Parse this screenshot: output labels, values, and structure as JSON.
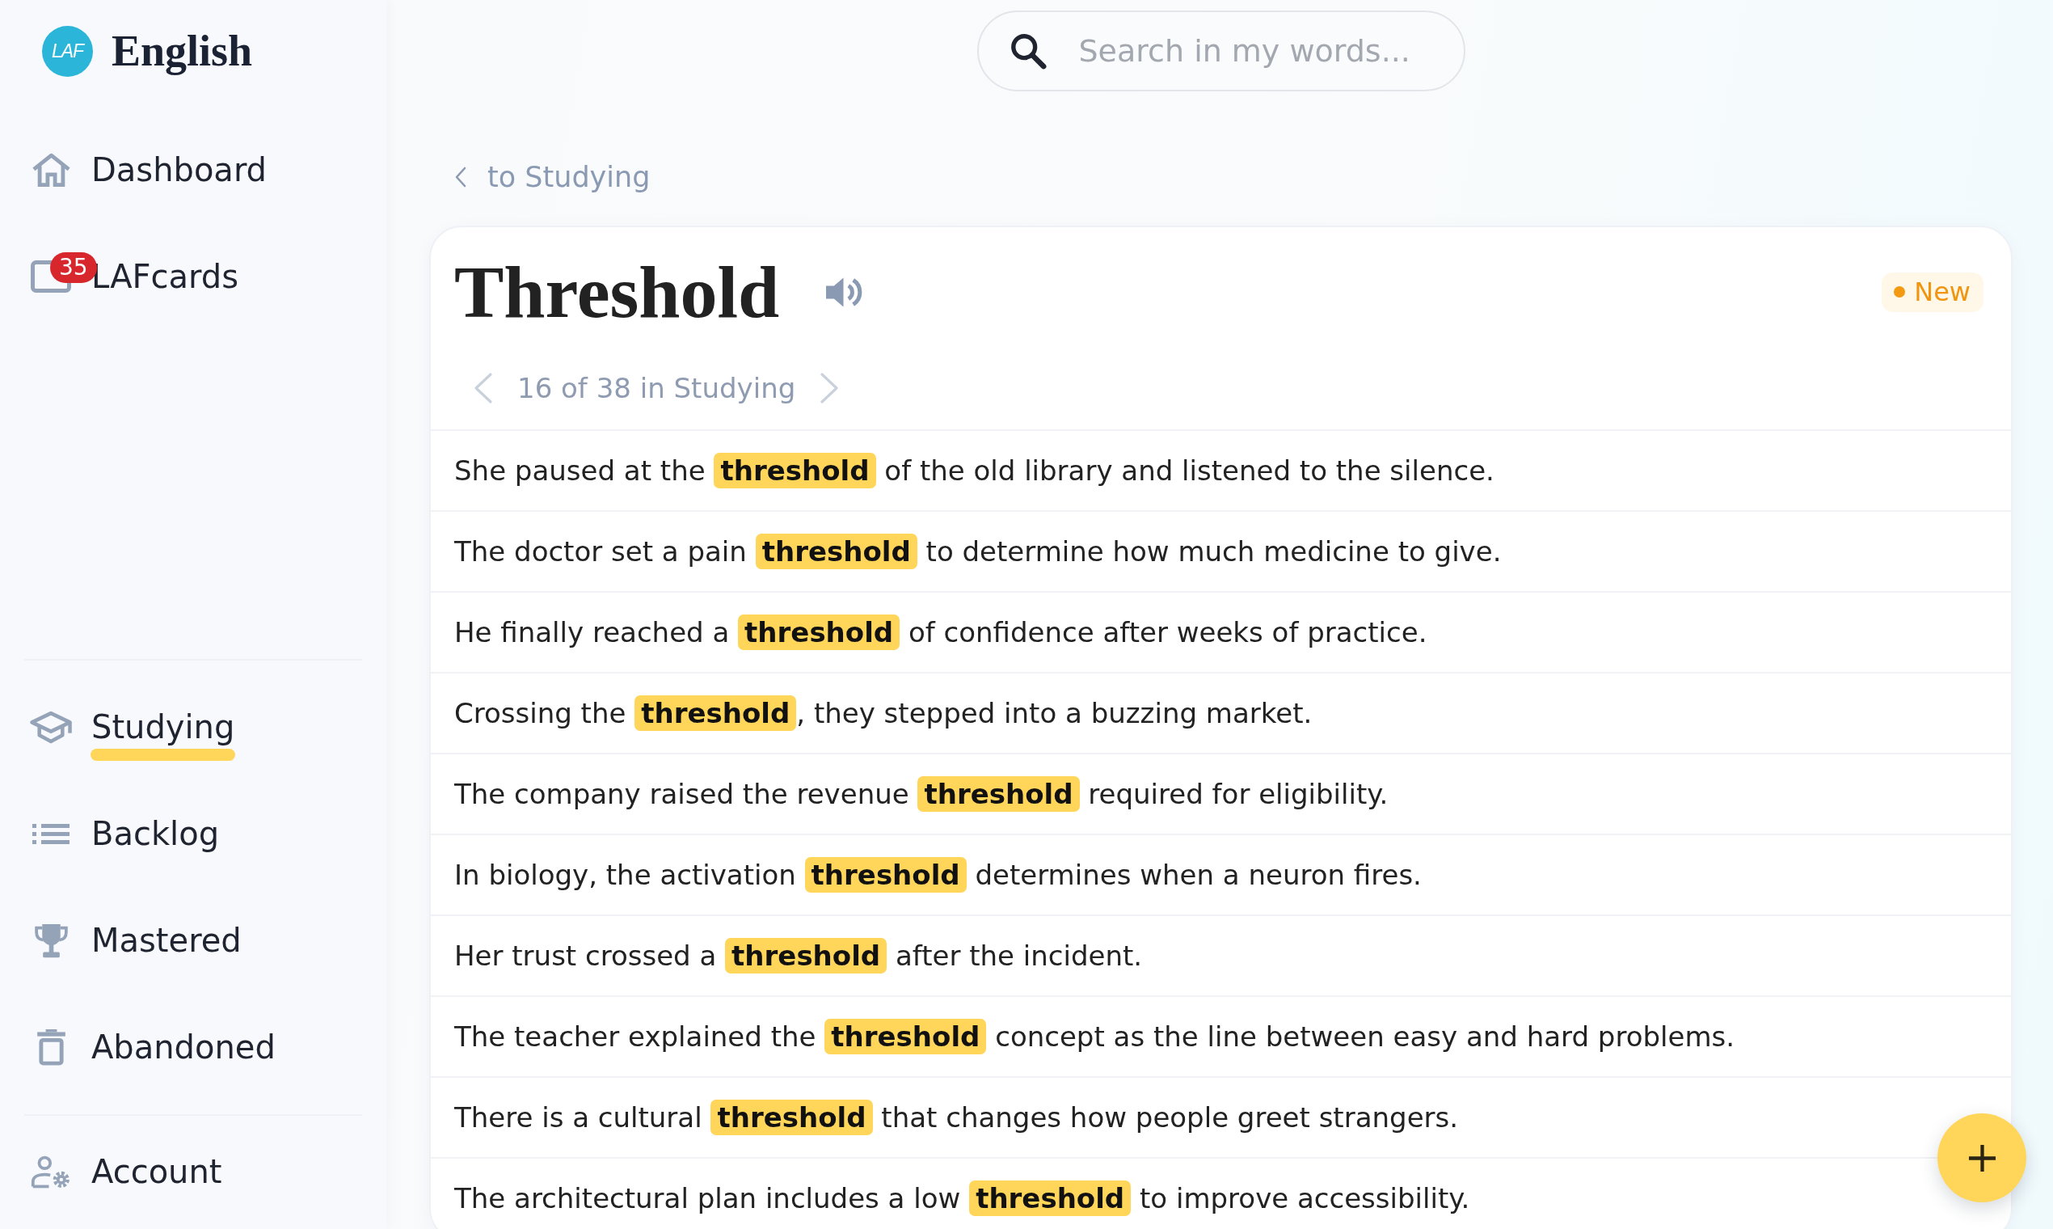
{
  "sidebar": {
    "logo": {
      "mark": "LAF",
      "title": "English"
    },
    "primary_items": [
      {
        "label": "Dashboard",
        "selected": false
      },
      {
        "label": "LAFcards",
        "badge": "35",
        "selected": false
      }
    ],
    "list_items": [
      {
        "label": "Studying",
        "selected": true
      },
      {
        "label": "Backlog",
        "selected": false
      },
      {
        "label": "Mastered",
        "selected": false
      },
      {
        "label": "Abandoned",
        "selected": false
      }
    ],
    "footer_items": [
      {
        "label": "Account",
        "selected": false
      }
    ]
  },
  "search": {
    "placeholder": "Search in my words..."
  },
  "breadcrumb": {
    "label": "to Studying"
  },
  "word": {
    "title": "Threshold",
    "status": "New",
    "pager": "16 of 38 in Studying",
    "examples": [
      {
        "text": "She paused at the **threshold** of the old library and listened to the silence."
      },
      {
        "text": "The doctor set a pain **threshold** to determine how much medicine to give."
      },
      {
        "text": "He finally reached a **threshold** of confidence after weeks of practice."
      },
      {
        "text": "Crossing the **threshold**, they stepped into a buzzing market."
      },
      {
        "text": "The company raised the revenue **threshold** required for eligibility."
      },
      {
        "text": "In biology, the activation **threshold** determines when a neuron fires."
      },
      {
        "text": "Her trust crossed a **threshold** after the incident."
      },
      {
        "text": "The teacher explained the **threshold** concept as the line between easy and hard problems."
      },
      {
        "text": "There is a cultural **threshold** that changes how people greet strangers."
      },
      {
        "text": "The architectural plan includes a low **threshold** to improve accessibility."
      }
    ]
  }
}
